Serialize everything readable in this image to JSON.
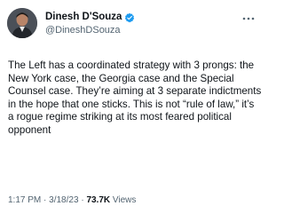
{
  "author": {
    "display_name": "Dinesh D'Souza",
    "handle": "@DineshDSouza",
    "verified": true,
    "verified_color": "#1d9bf0"
  },
  "tweet": {
    "text": "The Left has a coordinated strategy with 3 prongs: the New York case, the Georgia case and the Special Counsel case. They’re aiming at 3 separate indictments in the hope that one sticks. This is not “rule of law,” it’s a rogue regime striking at its most feared political opponent",
    "time": "1:17 PM",
    "date": "3/18/23",
    "separator": "·",
    "views_count": "73.7K",
    "views_label": "Views"
  },
  "icons": {
    "avatar": "profile-photo",
    "verified": "verified-badge-icon",
    "more": "more-options-icon"
  }
}
